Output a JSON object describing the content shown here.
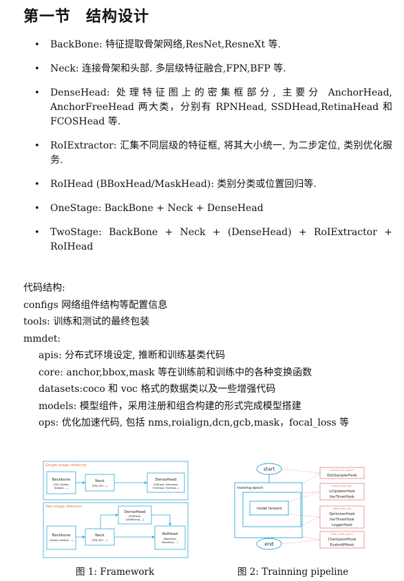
{
  "section": {
    "number": "第一节",
    "title": "结构设计"
  },
  "bullets": [
    "BackBone: 特征提取骨架网络,ResNet,ResneXt 等.",
    "Neck: 连接骨架和头部. 多层级特征融合,FPN,BFP 等.",
    "DenseHead: 处理特征图上的密集框部分, 主要分 AnchorHead, AnchorFreeHead 两大类，分别有 RPNHead, SSDHead,RetinaHead 和 FCOSHead 等.",
    "RoIExtractor: 汇集不同层级的特征框, 将其大小统一, 为二步定位, 类别优化服务.",
    "RoIHead (BBoxHead/MaskHead): 类别分类或位置回归等.",
    "OneStage: BackBone + Neck + DenseHead",
    "TwoStage: BackBone + Neck + (DenseHead) + RoIExtractor + RoIHead"
  ],
  "code": {
    "heading": "代码结构:",
    "configs": "configs 网络组件结构等配置信息",
    "tools": "tools: 训练和测试的最终包装",
    "mmdet": "mmdet:",
    "apis": "apis: 分布式环境设定, 推断和训练基类代码",
    "core": "core: anchor,bbox,mask 等在训练前和训练中的各种变换函数",
    "datasets": "datasets:coco 和 voc 格式的数据类以及一些增强代码",
    "models": "models: 模型组件，采用注册和组合构建的形式完成模型搭建",
    "ops": "ops: 优化加速代码, 包括 nms,roialign,dcn,gcb,mask，focal_loss 等"
  },
  "figure1": {
    "caption": "图 1: Framework",
    "single_label": "Single-stage detector",
    "two_label": "Two-stage detector",
    "s_backbone": "Backbone",
    "s_backbone_sub1": "(VGG, ResNet,",
    "s_backbone_sub2": "ResNeXt, ...)",
    "s_neck": "Neck",
    "s_neck_sub": "(FPN, BFP, ...)",
    "s_dense": "DenseHead",
    "s_dense_sub1": "(SSDHead, RetinaHead,",
    "s_dense_sub2": "FCOSHead, FSAFHead...)",
    "t_dense": "DenseHead",
    "t_dense_sub1": "(RPNHead,",
    "t_dense_sub2": "GARPNHead, ...)",
    "t_backbone": "Backbone",
    "t_backbone_sub": "(ResNet, ResNeXt, ...)",
    "t_neck": "Neck",
    "t_neck_sub": "(FPN, BFP, ...)",
    "t_roi": "RoIHead",
    "t_roi_sub1": "(BBoxHead,",
    "t_roi_sub2": "MaskHead, ...)"
  },
  "figure2": {
    "caption": "图 2: Trainning pipeline",
    "start": "start",
    "end": "end",
    "epoch": "training epoch",
    "model": "model forward",
    "h1_label": "before_train_epoch",
    "h1_a": "DistSamplerHook",
    "h2_label": "before_train_iter",
    "h2_a": "LrUpdaterHook",
    "h2_b": "IterTimerHook",
    "h3_label": "after_train_iter",
    "h3_a": "OptimizerHook",
    "h3_b": "IterTimerHook",
    "h3_c": "LoggerHook",
    "h4_label": "after_train_epoch",
    "h4_a": "CheckpointHook",
    "h4_b": "EvalmAPHook"
  },
  "colors": {
    "blue": "#2aa7d8",
    "red": "#e06b6b",
    "gray_text": "#333333"
  }
}
